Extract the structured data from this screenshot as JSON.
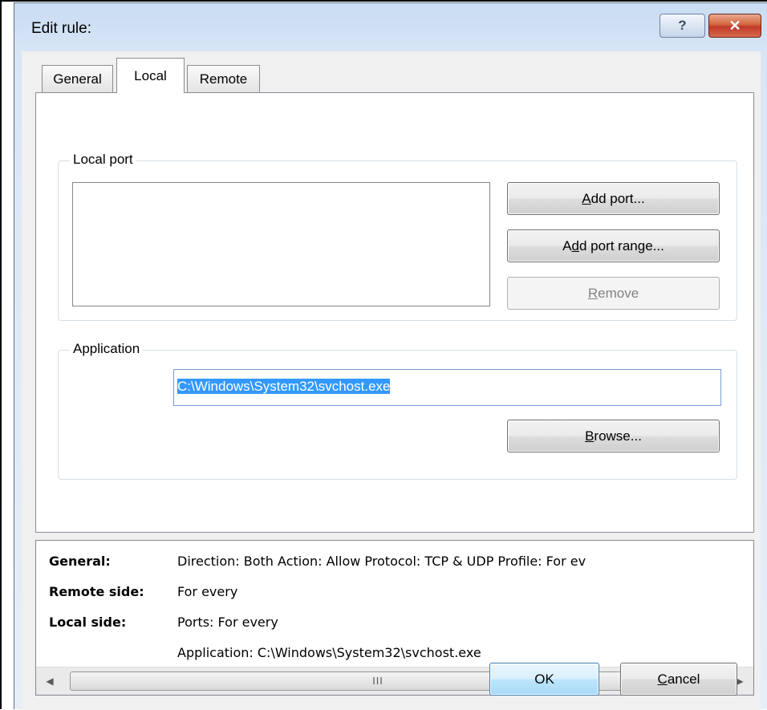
{
  "window": {
    "title": "Edit rule:",
    "help_label": "?",
    "close_label": "✕"
  },
  "tabs": [
    {
      "label": "General"
    },
    {
      "label": "Local"
    },
    {
      "label": "Remote"
    }
  ],
  "local_port": {
    "legend": "Local port",
    "items": [],
    "add_port": {
      "pre": "",
      "key": "A",
      "post": "dd port..."
    },
    "add_port_range": {
      "pre": "A",
      "key": "d",
      "post": "d port range..."
    },
    "remove": {
      "pre": "",
      "key": "R",
      "post": "emove"
    }
  },
  "application": {
    "legend": "Application",
    "path": "C:\\Windows\\System32\\svchost.exe",
    "browse": {
      "pre": "",
      "key": "B",
      "post": "rowse..."
    }
  },
  "summary": {
    "general_label": "General:",
    "general_value": "Direction: Both   Action: Allow   Protocol: TCP & UDP   Profile: For ev",
    "remote_label": "Remote side:",
    "remote_value": "For every",
    "local_label": "Local side:",
    "local_ports": "Ports: For every",
    "local_app": "Application: C:\\Windows\\System32\\svchost.exe",
    "scroll_grip": "III"
  },
  "footer": {
    "ok": "OK",
    "cancel": {
      "pre": "",
      "key": "C",
      "post": "ancel"
    }
  }
}
